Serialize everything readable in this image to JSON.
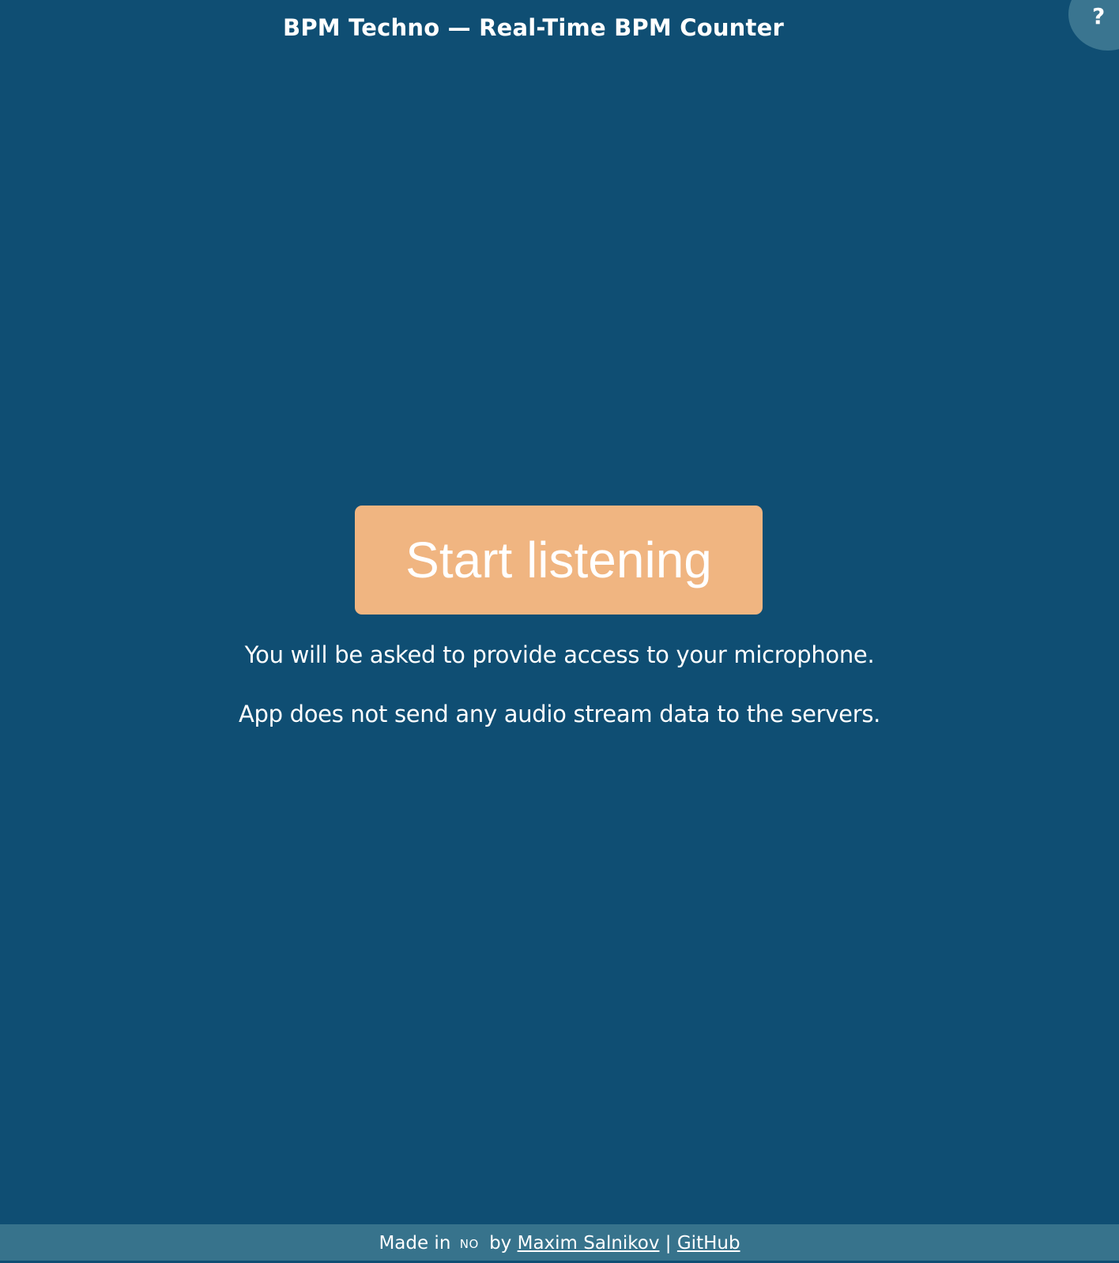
{
  "header": {
    "title": "BPM Techno — Real-Time BPM Counter",
    "help_label": "?"
  },
  "main": {
    "start_button_label": "Start listening",
    "mic_notice": "You will be asked to provide access to your microphone.",
    "privacy_notice": "App does not send any audio stream data to the servers."
  },
  "footer": {
    "made_in_label": "Made in",
    "country_flag": "NO",
    "by_label": "by",
    "author_link": "Maxim Salnikov",
    "separator": "|",
    "github_link": "GitHub"
  },
  "colors": {
    "background": "#0f4e73",
    "accent_button": "#f0b581",
    "footer_background": "#37738c",
    "help_button_background": "#3a7590"
  }
}
